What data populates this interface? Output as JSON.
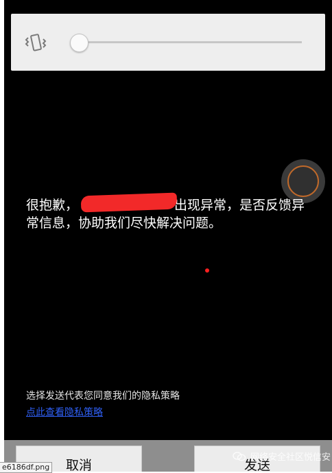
{
  "volume_panel": {
    "icon": "vibrate-icon",
    "slider_value": 0
  },
  "dialog": {
    "message_start": "很抱歉，",
    "message_end": "出现异常，是否反馈异常信息，协助我们尽快解决问题。",
    "privacy_note": "选择发送代表您同意我们的隐私策略",
    "privacy_link": "点此查看隐私策略"
  },
  "buttons": {
    "cancel": "取消",
    "send": "发送"
  },
  "tooltip": {
    "filename": "e6186df.png"
  },
  "watermark": {
    "text": "网络安全社区悦信安"
  },
  "colors": {
    "background": "#000000",
    "panel": "#eeeeee",
    "link": "#2f5ff3",
    "redaction": "#ff2b2b",
    "float_ring": "#c0692a"
  }
}
